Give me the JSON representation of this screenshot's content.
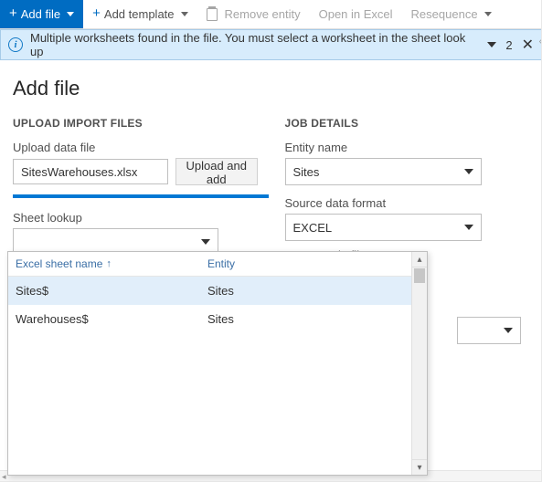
{
  "toolbar": {
    "add_file": "Add file",
    "add_template": "Add template",
    "remove_entity": "Remove entity",
    "open_excel": "Open in Excel",
    "resequence": "Resequence"
  },
  "infobar": {
    "message": "Multiple worksheets found in the file. You must select a worksheet in the sheet look up",
    "count": "2"
  },
  "page": {
    "title": "Add file"
  },
  "upload": {
    "section": "UPLOAD IMPORT FILES",
    "label_file": "Upload data file",
    "filename": "SitesWarehouses.xlsx",
    "upload_btn": "Upload and add",
    "sheet_lookup_label": "Sheet lookup",
    "sheet_lookup_value": ""
  },
  "job": {
    "section": "JOB DETAILS",
    "entity_label": "Entity name",
    "entity_value": "Sites",
    "source_label": "Source data format",
    "source_value": "EXCEL",
    "sample_label_cut": "Use sample file"
  },
  "dropdown": {
    "col1": "Excel sheet name",
    "col2": "Entity",
    "rows": [
      {
        "sheet": "Sites$",
        "entity": "Sites"
      },
      {
        "sheet": "Warehouses$",
        "entity": "Sites"
      }
    ]
  }
}
